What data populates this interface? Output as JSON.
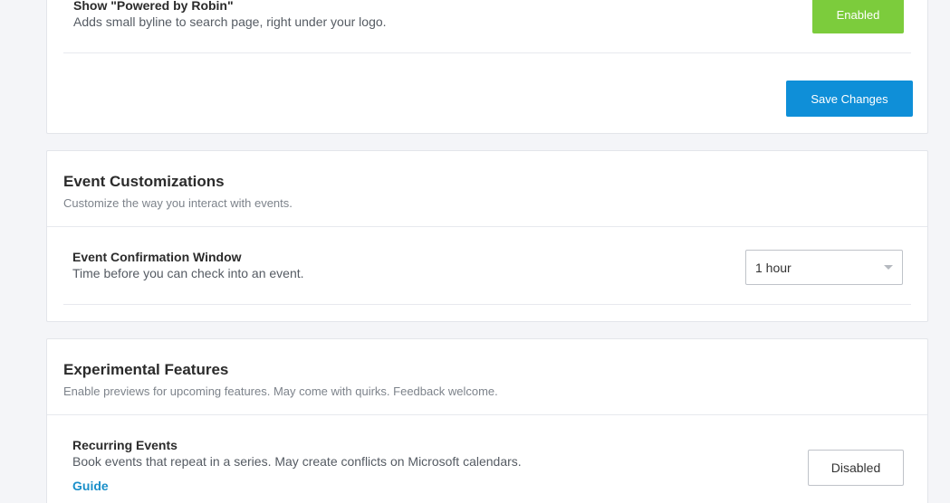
{
  "branding_section": {
    "powered_by": {
      "title": "Show \"Powered by Robin\"",
      "description": "Adds small byline to search page, right under your logo.",
      "status_label": "Enabled"
    },
    "save_label": "Save Changes"
  },
  "event_customizations": {
    "title": "Event Customizations",
    "subtitle": "Customize the way you interact with events.",
    "confirmation_window": {
      "title": "Event Confirmation Window",
      "description": "Time before you can check into an event.",
      "selected_value": "1 hour"
    }
  },
  "experimental_features": {
    "title": "Experimental Features",
    "subtitle": "Enable previews for upcoming features. May come with quirks. Feedback welcome.",
    "recurring_events": {
      "title": "Recurring Events",
      "description": "Book events that repeat in a series. May create conflicts on Microsoft calendars.",
      "guide_label": "Guide",
      "status_label": "Disabled"
    }
  },
  "colors": {
    "enabled_green": "#7ccc3c",
    "primary_blue": "#0f8fd8",
    "link_blue": "#1a8fc9"
  }
}
